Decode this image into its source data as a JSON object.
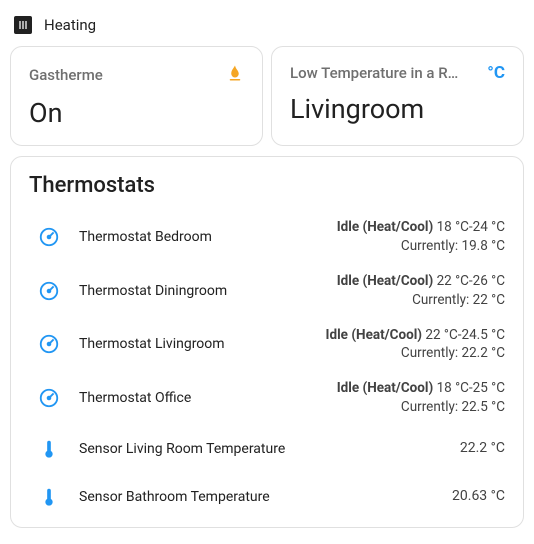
{
  "section": {
    "title": "Heating",
    "icon": "heating-icon"
  },
  "cards": [
    {
      "label": "Gastherme",
      "value": "On",
      "icon": "flame-icon"
    },
    {
      "label": "Low Temperature in a R…",
      "value": "Livingroom",
      "icon": "celsius-icon"
    }
  ],
  "panel": {
    "title": "Thermostats",
    "rows": [
      {
        "icon": "gauge-icon",
        "name": "Thermostat Bedroom",
        "state": "Idle (Heat/Cool)",
        "range": "18 °C-24 °C",
        "current": "Currently: 19.8 °C"
      },
      {
        "icon": "gauge-icon",
        "name": "Thermostat Diningroom",
        "state": "Idle (Heat/Cool)",
        "range": "22 °C-26 °C",
        "current": "Currently: 22 °C"
      },
      {
        "icon": "gauge-icon",
        "name": "Thermostat Livingroom",
        "state": "Idle (Heat/Cool)",
        "range": "22 °C-24.5 °C",
        "current": "Currently: 22.2 °C"
      },
      {
        "icon": "gauge-icon",
        "name": "Thermostat Office",
        "state": "Idle (Heat/Cool)",
        "range": "18 °C-25 °C",
        "current": "Currently: 22.5 °C"
      },
      {
        "icon": "thermometer-icon",
        "name": "Sensor Living Room Temperature",
        "value": "22.2 °C"
      },
      {
        "icon": "thermometer-icon",
        "name": "Sensor Bathroom Temperature",
        "value": "20.63 °C"
      }
    ]
  }
}
